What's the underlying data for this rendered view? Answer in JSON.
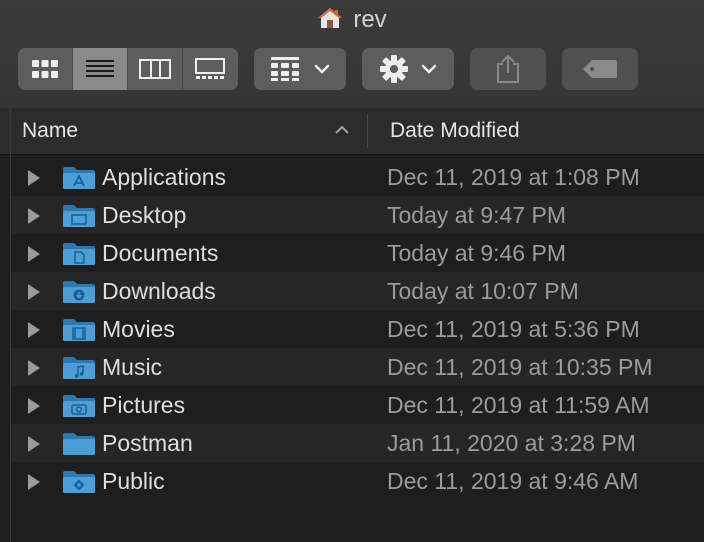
{
  "window": {
    "title": "rev",
    "title_icon": "home-icon"
  },
  "toolbar": {
    "view_modes": [
      {
        "name": "view-icons",
        "icon": "grid-icon",
        "active": false
      },
      {
        "name": "view-list",
        "icon": "list-icon",
        "active": true
      },
      {
        "name": "view-columns",
        "icon": "columns-icon",
        "active": false
      },
      {
        "name": "view-gallery",
        "icon": "gallery-icon",
        "active": false
      }
    ],
    "group_icon": "group-by-icon",
    "action_icon": "gear-icon",
    "share_icon": "share-icon",
    "tag_icon": "tag-icon"
  },
  "columns": {
    "name": "Name",
    "date": "Date Modified"
  },
  "rows": [
    {
      "name": "Applications",
      "date": "Dec 11, 2019 at 1:08 PM",
      "icon": "applications-folder-icon"
    },
    {
      "name": "Desktop",
      "date": "Today at 9:47 PM",
      "icon": "desktop-folder-icon"
    },
    {
      "name": "Documents",
      "date": "Today at 9:46 PM",
      "icon": "documents-folder-icon"
    },
    {
      "name": "Downloads",
      "date": "Today at 10:07 PM",
      "icon": "downloads-folder-icon"
    },
    {
      "name": "Movies",
      "date": "Dec 11, 2019 at 5:36 PM",
      "icon": "movies-folder-icon"
    },
    {
      "name": "Music",
      "date": "Dec 11, 2019 at 10:35 PM",
      "icon": "music-folder-icon"
    },
    {
      "name": "Pictures",
      "date": "Dec 11, 2019 at 11:59 AM",
      "icon": "pictures-folder-icon"
    },
    {
      "name": "Postman",
      "date": "Jan 11, 2020 at 3:28 PM",
      "icon": "folder-icon"
    },
    {
      "name": "Public",
      "date": "Dec 11, 2019 at 9:46 AM",
      "icon": "public-folder-icon"
    }
  ],
  "colors": {
    "folder": "#4a9fd8",
    "folder_dark": "#2f78ad",
    "background": "#1e1e1e",
    "header": "#2c2c2c"
  }
}
